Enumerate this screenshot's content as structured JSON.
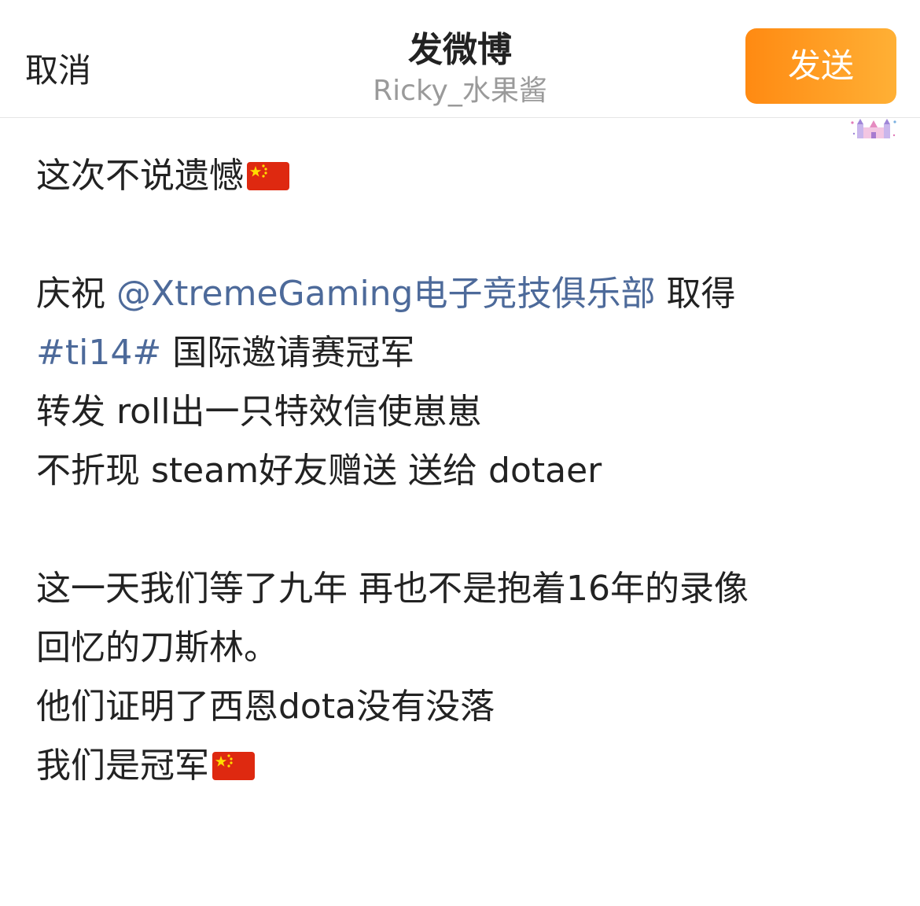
{
  "header": {
    "cancel_label": "取消",
    "title": "发微博",
    "username": "Ricky_水果酱",
    "send_label": "发送"
  },
  "colors": {
    "send_gradient_start": "#ff8a12",
    "send_gradient_end": "#ffb035",
    "link": "#4d6a9a",
    "text": "#222222",
    "subtitle": "#9a9a9a"
  },
  "post": {
    "line1": "这次不说遗憾",
    "line1_flag": "china-flag-emoji",
    "line2_pre": "庆祝 ",
    "line2_mention": "@XtremeGaming电子竞技俱乐部",
    "line2_post": " 取得",
    "line3_hashtag": "#ti14#",
    "line3_post": " 国际邀请赛冠军",
    "line4": "转发 roll出一只特效信使崽崽",
    "line5": "不折现 steam好友赠送 送给 dotaer",
    "line6": "这一天我们等了九年 再也不是抱着16年的录像",
    "line7": "回忆的刀斯林。",
    "line8": "他们证明了西恩dota没有没落",
    "line9": "我们是冠军",
    "line9_flag": "china-flag-emoji"
  },
  "decorations": {
    "sticker": "castle-sticker-icon"
  }
}
